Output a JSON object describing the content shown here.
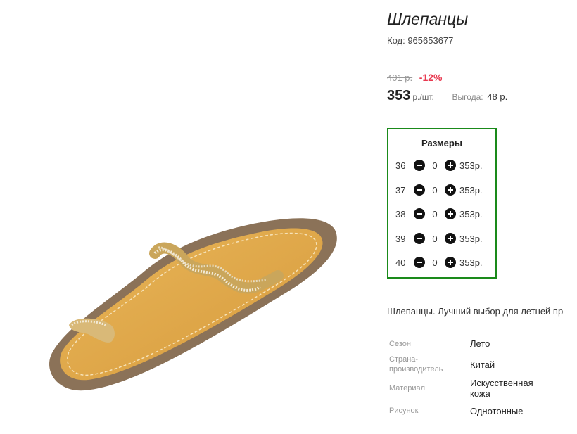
{
  "product": {
    "title": "Шлепанцы",
    "code": "Код: 965653677",
    "old_price": "401 р.",
    "discount": "-12%",
    "price": "353",
    "unit": "р./шт.",
    "savings_label": "Выгода:",
    "savings_value": "48 р.",
    "description": "Шлепанцы. Лучший выбор для летней пр"
  },
  "sizes": {
    "title": "Размеры",
    "rows": [
      {
        "size": "36",
        "qty": "0",
        "price": "353р."
      },
      {
        "size": "37",
        "qty": "0",
        "price": "353р."
      },
      {
        "size": "38",
        "qty": "0",
        "price": "353р."
      },
      {
        "size": "39",
        "qty": "0",
        "price": "353р."
      },
      {
        "size": "40",
        "qty": "0",
        "price": "353р."
      }
    ]
  },
  "attributes": [
    {
      "label": "Сезон",
      "value": "Лето"
    },
    {
      "label": "Страна-производитель",
      "value": "Китай"
    },
    {
      "label": "Материал",
      "value": "Искусственная кожа"
    },
    {
      "label": "Рисунок",
      "value": "Однотонные"
    }
  ],
  "colors": {
    "accent_discount": "#e8384f",
    "sizes_border": "#1a8a1a"
  },
  "icons": [
    "minus-circle-icon",
    "plus-circle-icon"
  ]
}
